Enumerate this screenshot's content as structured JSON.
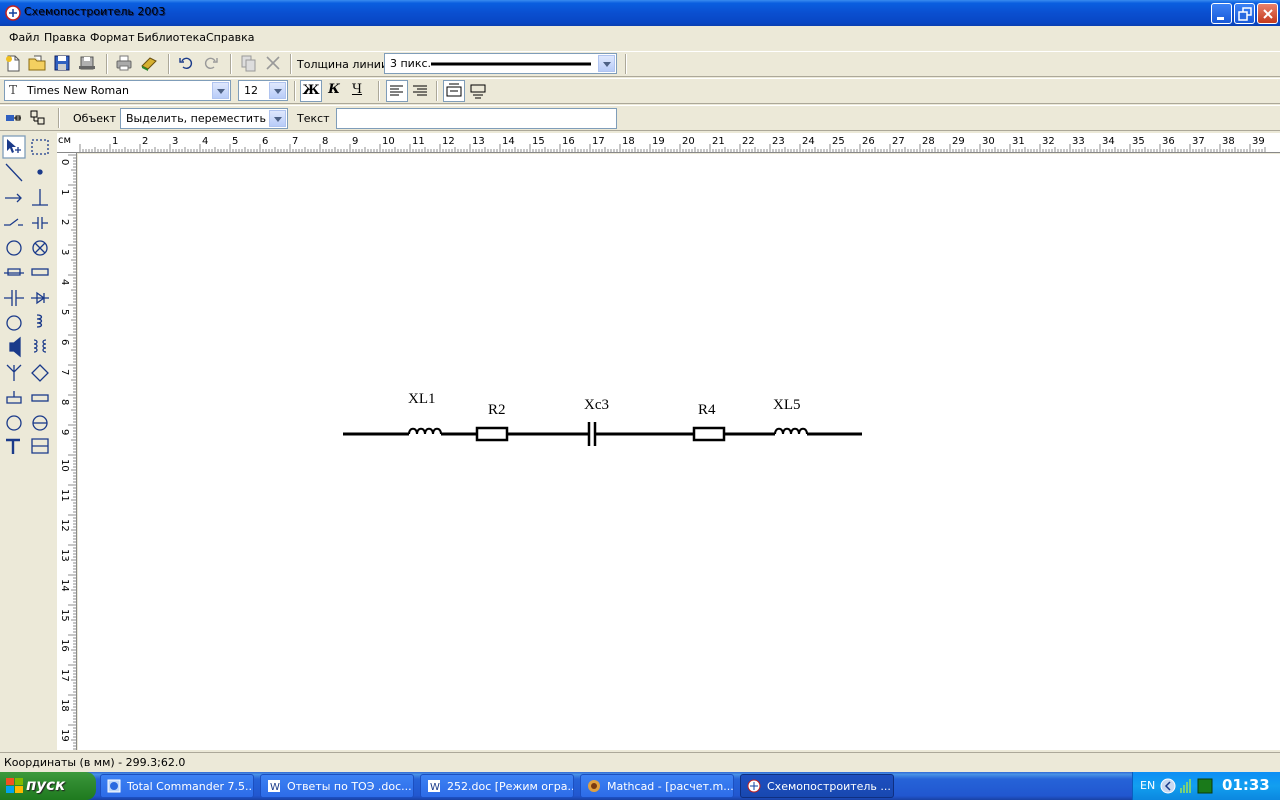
{
  "window": {
    "title": "Схемопостроитель 2003"
  },
  "menu": [
    "Файл",
    "Правка",
    "Формат",
    "Библиотека",
    "Справка"
  ],
  "toolbar": {
    "line_width_label": "Толщина линии",
    "line_width_value": "3 пикс."
  },
  "format_bar": {
    "font_name": "Times New Roman",
    "font_size": "12",
    "bold_label": "Ж",
    "italic_label": "К",
    "underline_label": "Ч"
  },
  "object_bar": {
    "object_label": "Объект",
    "object_value": "Выделить, переместить",
    "text_label": "Текст",
    "text_value": ""
  },
  "ruler": {
    "unit": "см",
    "h_ticks": [
      "1",
      "2",
      "3",
      "4",
      "5",
      "6",
      "7",
      "8",
      "9",
      "10",
      "11",
      "12",
      "13",
      "14",
      "15",
      "16",
      "17",
      "18",
      "19",
      "20",
      "21",
      "22",
      "23",
      "24",
      "25",
      "26",
      "27",
      "28",
      "29",
      "30",
      "31",
      "32",
      "33",
      "34",
      "35",
      "36",
      "37",
      "38",
      "39"
    ],
    "v_ticks": [
      "0",
      "1",
      "2",
      "3",
      "4",
      "5",
      "6",
      "7",
      "8",
      "9",
      "10",
      "11",
      "12",
      "13",
      "14",
      "15",
      "16",
      "17",
      "18",
      "19"
    ]
  },
  "schematic": {
    "labels": [
      "XL1",
      "R2",
      "Xc3",
      "R4",
      "XL5"
    ]
  },
  "status": {
    "coordinates": "Координаты (в мм) - 299.3;62.0"
  },
  "taskbar": {
    "start_label": "пуск",
    "tasks": [
      "Total Commander 7.5...",
      "Ответы по ТОЭ .doc...",
      "252.doc [Режим огра...",
      "Mathcad - [расчет.m...",
      "Схемопостроитель ..."
    ],
    "language": "EN",
    "clock": "01:33"
  }
}
